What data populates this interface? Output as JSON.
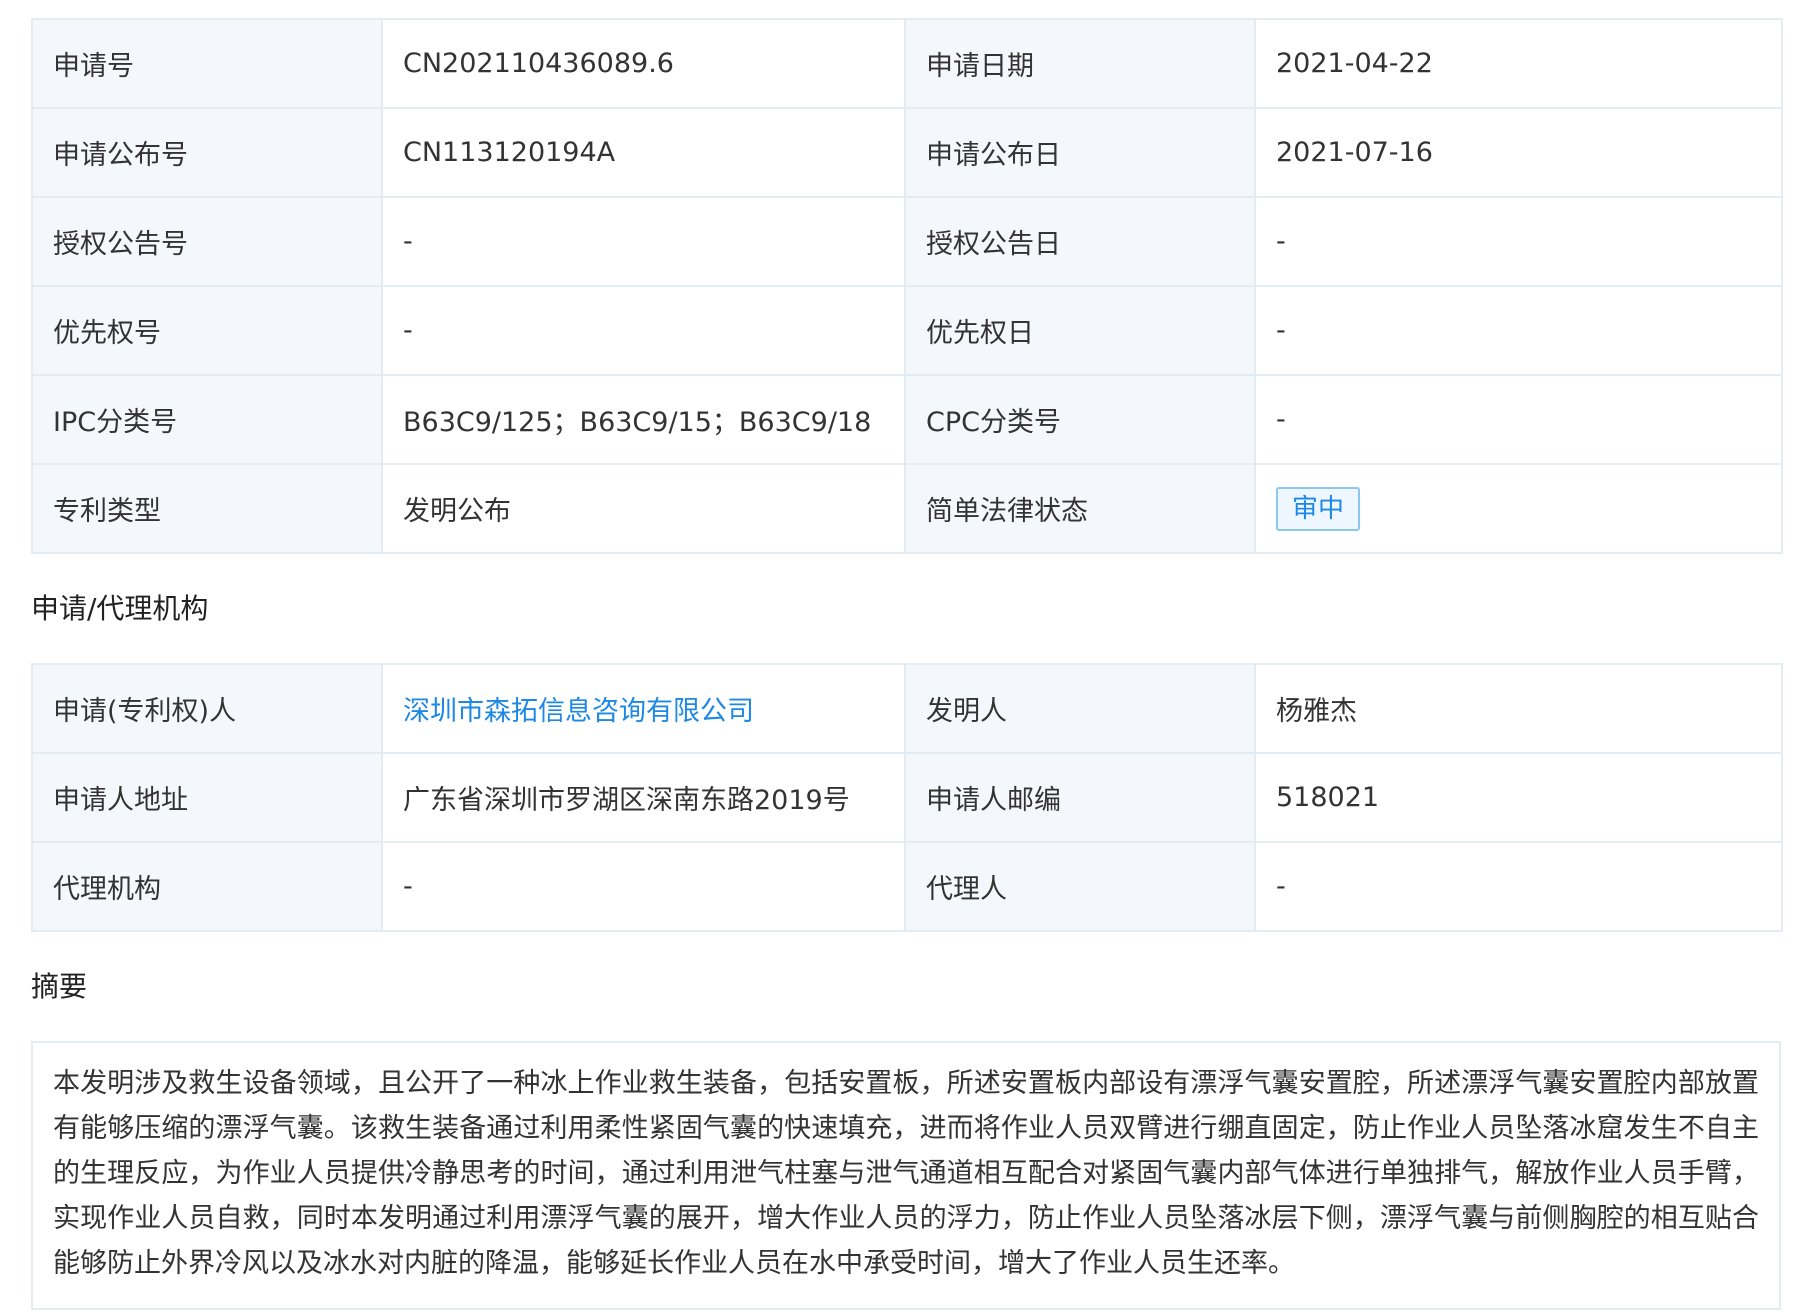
{
  "basic_info": {
    "rows": [
      {
        "label1": "申请号",
        "value1": "CN202110436089.6",
        "label2": "申请日期",
        "value2": "2021-04-22"
      },
      {
        "label1": "申请公布号",
        "value1": "CN113120194A",
        "label2": "申请公布日",
        "value2": "2021-07-16"
      },
      {
        "label1": "授权公告号",
        "value1": "-",
        "label2": "授权公告日",
        "value2": "-"
      },
      {
        "label1": "优先权号",
        "value1": "-",
        "label2": "优先权日",
        "value2": "-"
      },
      {
        "label1": "IPC分类号",
        "value1": "B63C9/125；B63C9/15；B63C9/18",
        "label2": "CPC分类号",
        "value2": "-"
      },
      {
        "label1": "专利类型",
        "value1": "发明公布",
        "label2": "简单法律状态",
        "value2": "审中"
      }
    ]
  },
  "applicant_section": {
    "title": "申请/代理机构",
    "rows": [
      {
        "label1": "申请(专利权)人",
        "value1": "深圳市森拓信息咨询有限公司",
        "label2": "发明人",
        "value2": "杨雅杰"
      },
      {
        "label1": "申请人地址",
        "value1": "广东省深圳市罗湖区深南东路2019号",
        "label2": "申请人邮编",
        "value2": "518021"
      },
      {
        "label1": "代理机构",
        "value1": "-",
        "label2": "代理人",
        "value2": "-"
      }
    ]
  },
  "abstract_section": {
    "title": "摘要",
    "text": "本发明涉及救生设备领域，且公开了一种冰上作业救生装备，包括安置板，所述安置板内部设有漂浮气囊安置腔，所述漂浮气囊安置腔内部放置有能够压缩的漂浮气囊。该救生装备通过利用柔性紧固气囊的快速填充，进而将作业人员双臂进行绷直固定，防止作业人员坠落冰窟发生不自主的生理反应，为作业人员提供冷静思考的时间，通过利用泄气柱塞与泄气通道相互配合对紧固气囊内部气体进行单独排气，解放作业人员手臂，实现作业人员自救，同时本发明通过利用漂浮气囊的展开，增大作业人员的浮力，防止作业人员坠落冰层下侧，漂浮气囊与前侧胸腔的相互贴合能够防止外界冷风以及冰水对内脏的降温，能够延长作业人员在水中承受时间，增大了作业人员生还率。"
  },
  "colors": {
    "label_bg": "#f4f7fb",
    "border": "#e4ebf3",
    "link": "#1e88e5",
    "badge_border": "#8cc7f2",
    "badge_bg": "#eef7ff"
  }
}
